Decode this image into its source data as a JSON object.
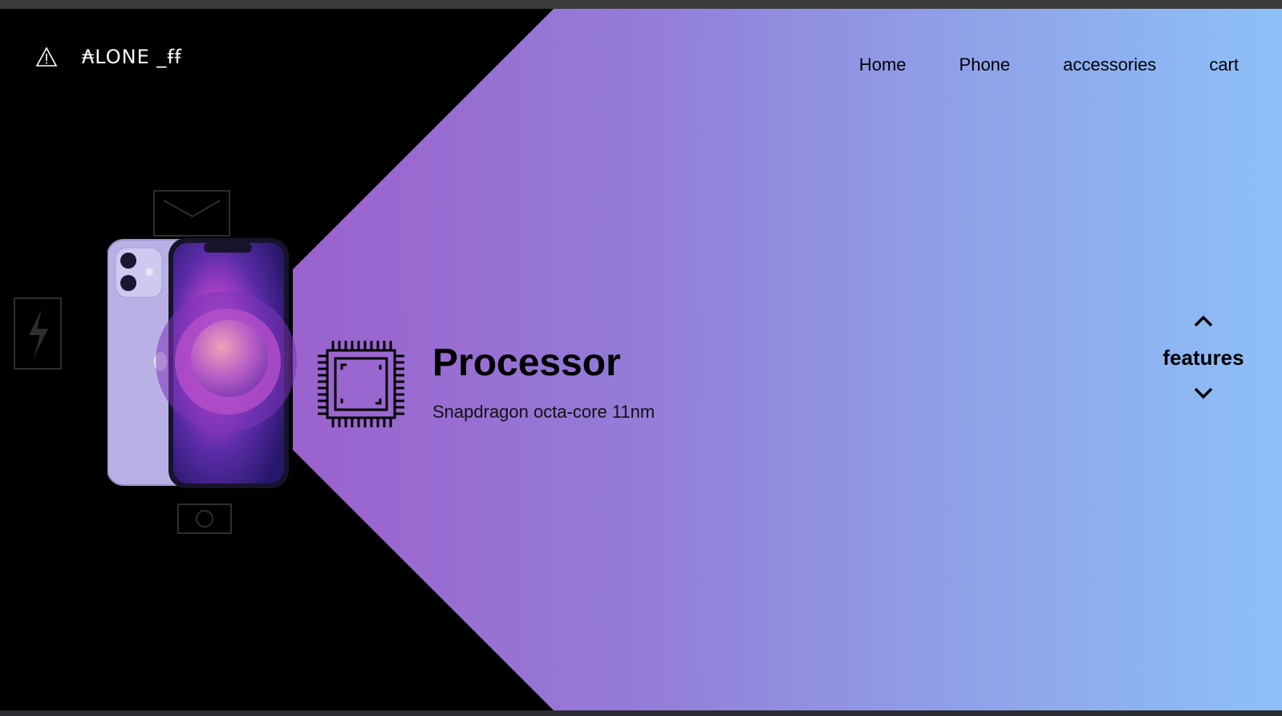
{
  "brand": {
    "logo_text": "₳LONE _ꞙꞙ",
    "warning_icon": "warning-icon",
    "apple_icon": "apple-icon"
  },
  "nav": {
    "items": [
      "Home",
      "Phone",
      "accessories",
      "cart"
    ]
  },
  "feature": {
    "title": "Processor",
    "description": "Snapdragon octa-core 11nm",
    "icon": "cpu-icon"
  },
  "features_nav": {
    "label": "features",
    "up_icon": "chevron-up-icon",
    "down_icon": "chevron-down-icon"
  },
  "colors": {
    "background": "#000000",
    "gradient_start": "#9c55c8",
    "gradient_end": "#8ec0f8",
    "phone_body": "#b8aee6"
  }
}
